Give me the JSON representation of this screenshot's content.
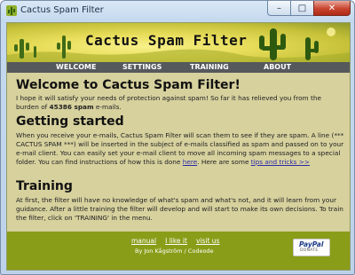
{
  "window": {
    "title": "Cactus Spam Filter",
    "min_glyph": "–",
    "max_glyph": "□",
    "close_glyph": "✕"
  },
  "banner": {
    "title": "Cactus Spam Filter"
  },
  "nav": {
    "items": [
      "WELCOME",
      "SETTINGS",
      "TRAINING",
      "ABOUT"
    ]
  },
  "welcome": {
    "heading": "Welcome to Cactus Spam Filter!",
    "text_before": "I hope it will satisfy your needs of protection against spam! So far it has relieved you from the burden of ",
    "count": "45386 spam",
    "text_after": " e-mails."
  },
  "getting_started": {
    "heading": "Getting started",
    "text_1": "When you receive your e-mails, Cactus Spam Filter will scan them to see if they are spam. A line (*** CACTUS SPAM ***) will be inserted in the subject of e-mails classified as spam and passed on to your e-mail client. You can easily set your e-mail client to move all incoming spam messages to a special folder. You can find instructions of how this is done ",
    "link_here": "here",
    "text_2": ". Here are some ",
    "link_tips": "tips and tricks >>"
  },
  "training": {
    "heading": "Training",
    "text": "At first, the filter will have no knowledge of what's spam and what's not, and it will learn from your guidance. After a little training the filter will develop and will start to make its own decisions. To train the filter, click on 'TRAINING' in the menu."
  },
  "footer": {
    "links": [
      "manual",
      "I like it",
      "visit us"
    ],
    "credit": "By Jon Kågström / Codeode",
    "paypal_brand": "PayPal",
    "paypal_caption": "DONATE"
  },
  "colors": {
    "content_bg": "#d7d19e",
    "footer_bg": "#8a9d18",
    "nav_bg": "#55595c",
    "link": "#2a2aa8"
  }
}
